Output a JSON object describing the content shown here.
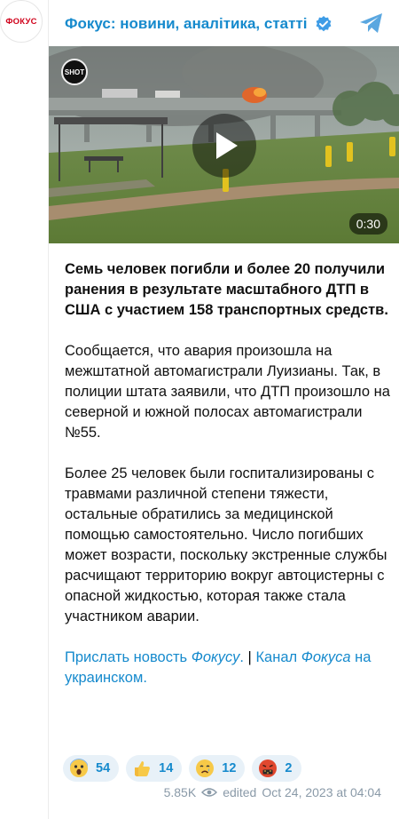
{
  "avatar": {
    "label": "ФОКУС"
  },
  "channel": {
    "name": "Фокус: новини, аналітика, статті"
  },
  "media": {
    "logo": "SHOT",
    "duration": "0:30"
  },
  "post": {
    "headline": "Семь человек погибли и более 20 получили ранения в результате масштабного ДТП в США с участием 158 транспортных средств.",
    "paragraph_1": "Сообщается, что авария произошла на межштатной автомагистрали Луизианы. Так, в полиции штата заявили, что ДТП произошло на северной и южной полосах автомагистрали №55.",
    "paragraph_2": "Более 25 человек были госпитализированы с травмами различной степени тяжести, остальные обратились за медицинской помощью самостоятельно. Число погибших может возрасти, поскольку экстренные службы расчищают территорию вокруг автоцистерны с опасной жидкостью, которая также стала участником аварии.",
    "links": {
      "send_news_text": "Прислать новость ",
      "send_news_italic": "Фокусу",
      "send_news_dot": ".",
      "separator": " | ",
      "channel_text": "Канал",
      "channel_italic": "Фокуса",
      "channel_suffix": " на украинском."
    }
  },
  "reactions": [
    {
      "emoji": "screaming-face-icon",
      "count": "54"
    },
    {
      "emoji": "thumbs-up-icon",
      "count": "14"
    },
    {
      "emoji": "crying-face-icon",
      "count": "12"
    },
    {
      "emoji": "cursing-face-icon",
      "count": "2"
    }
  ],
  "meta": {
    "views": "5.85K",
    "status": "edited",
    "timestamp": "Oct 24, 2023 at 04:04"
  },
  "colors": {
    "accent": "#168acd",
    "reaction_bg": "#e8f1f8",
    "meta": "#8a9aa8",
    "brand_red": "#d0021b"
  }
}
